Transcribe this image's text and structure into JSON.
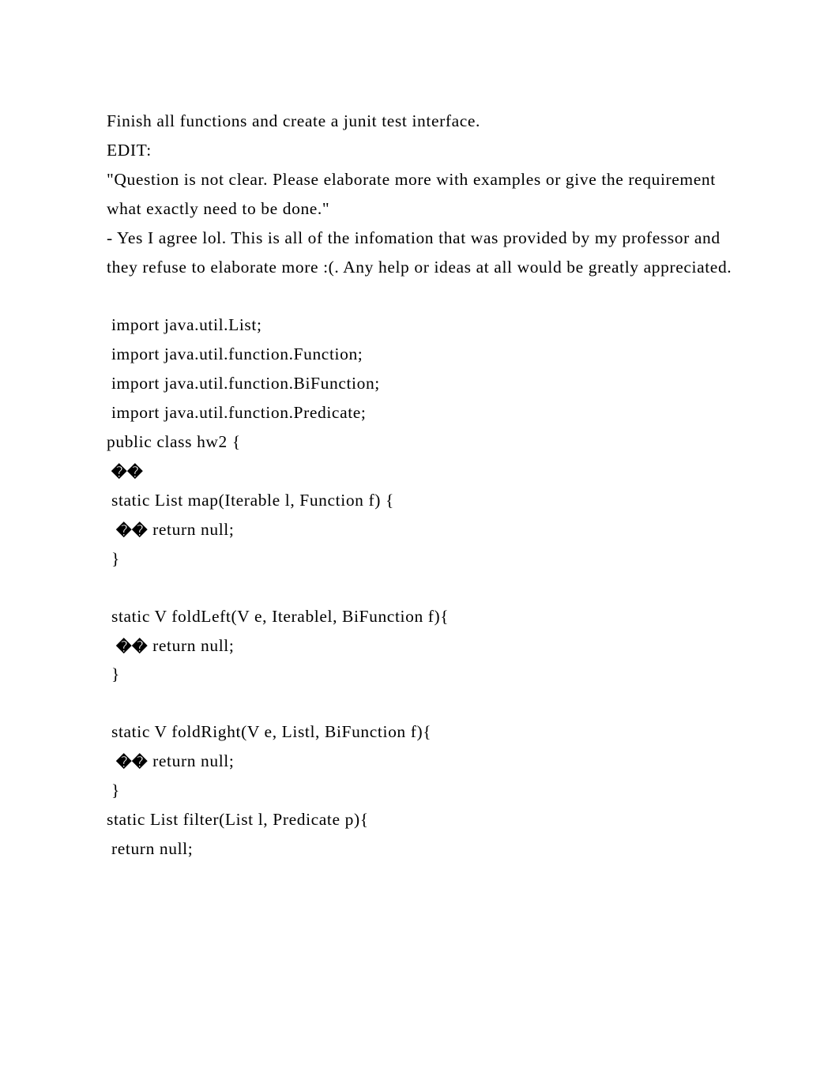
{
  "intro": {
    "line1": "Finish all functions and create a junit test interface.",
    "line2": "EDIT:",
    "line3": "\"Question is not clear. Please elaborate more with examples or give the requirement what exactly need to be done.\"",
    "line4": "- Yes I agree lol. This is all of the infomation that was provided by my professor and they refuse to elaborate more :(. Any help or ideas at all would be greatly appreciated."
  },
  "code": {
    "glyph": "�",
    "l1": " import java.util.List;",
    "l2": " import java.util.function.Function;",
    "l3": " import java.util.function.BiFunction;",
    "l4": " import java.util.function.Predicate;",
    "l5": "public class hw2 {",
    "l6a": " ",
    "l7": " static List map(Iterable l, Function f) {",
    "l8a": "  ",
    "l8b": " return null;",
    "l9": " }",
    "l10": " static V foldLeft(V e, Iterablel, BiFunction f){",
    "l11a": "  ",
    "l11b": " return null;",
    "l12": " }",
    "l13": " static V foldRight(V e, Listl, BiFunction f){",
    "l14a": "  ",
    "l14b": " return null;",
    "l15": " }",
    "l16": "static List filter(List l, Predicate p){",
    "l17": " return null;"
  }
}
